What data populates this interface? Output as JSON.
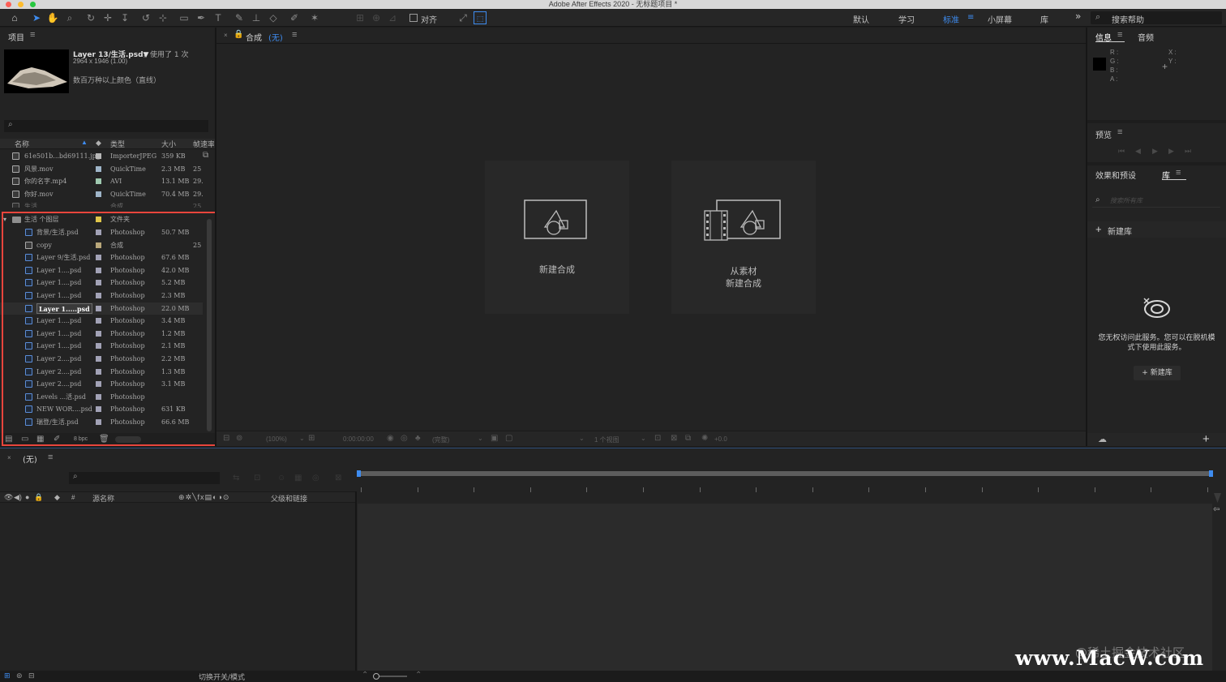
{
  "title_bar": {
    "title": "Adobe After Effects 2020 - 无标题项目 *"
  },
  "toolbar": {
    "snap_label": "对齐",
    "workspaces": [
      "默认",
      "学习",
      "标准",
      "小屏幕",
      "库"
    ],
    "active_workspace": "标准",
    "help_search_placeholder": "搜索帮助"
  },
  "project_panel": {
    "tab": "项目",
    "asset": {
      "name": "Layer 13/生活.psd▼",
      "used": "，使用了 1 次",
      "dimensions": "2964 x 1946 (1.00)",
      "color_info": "数百万种以上颜色（直线）"
    },
    "columns": {
      "name": "名称",
      "type": "类型",
      "size": "大小",
      "fps": "帧速率"
    },
    "items": [
      {
        "name": "61e501b...bd69111.jpg",
        "type": "ImporterJPEG",
        "size": "359 KB",
        "fps": ""
      },
      {
        "name": "风景.mov",
        "type": "QuickTime",
        "size": "2.3 MB",
        "fps": "25"
      },
      {
        "name": "你的名字.mp4",
        "type": "AVI",
        "size": "13.1 MB",
        "fps": "29."
      },
      {
        "name": "你好.mov",
        "type": "QuickTime",
        "size": "70.4 MB",
        "fps": "29."
      },
      {
        "name": "生活",
        "type": "合成",
        "size": "",
        "fps": "25"
      }
    ],
    "folder": {
      "name": "生活 个图层",
      "type": "文件夹"
    },
    "folder_items": [
      {
        "name": "背景/生活.psd",
        "type": "Photoshop",
        "size": "50.7 MB",
        "fps": ""
      },
      {
        "name": "copy",
        "type": "合成",
        "size": "",
        "fps": "25"
      },
      {
        "name": "Layer 9/生活.psd",
        "type": "Photoshop",
        "size": "67.6 MB",
        "fps": ""
      },
      {
        "name": "Layer 1....psd",
        "type": "Photoshop",
        "size": "42.0 MB",
        "fps": ""
      },
      {
        "name": "Layer 1....psd",
        "type": "Photoshop",
        "size": "5.2 MB",
        "fps": ""
      },
      {
        "name": "Layer 1....psd",
        "type": "Photoshop",
        "size": "2.3 MB",
        "fps": ""
      },
      {
        "name": "Layer 1.....psd",
        "type": "Photoshop",
        "size": "22.0 MB",
        "fps": ""
      },
      {
        "name": "Layer 1....psd",
        "type": "Photoshop",
        "size": "3.4 MB",
        "fps": ""
      },
      {
        "name": "Layer 1....psd",
        "type": "Photoshop",
        "size": "1.2 MB",
        "fps": ""
      },
      {
        "name": "Layer 1....psd",
        "type": "Photoshop",
        "size": "2.1 MB",
        "fps": ""
      },
      {
        "name": "Layer 2....psd",
        "type": "Photoshop",
        "size": "2.2 MB",
        "fps": ""
      },
      {
        "name": "Layer 2....psd",
        "type": "Photoshop",
        "size": "1.3 MB",
        "fps": ""
      },
      {
        "name": "Layer 2....psd",
        "type": "Photoshop",
        "size": "3.1 MB",
        "fps": ""
      },
      {
        "name": "Levels ...活.psd",
        "type": "Photoshop",
        "size": "",
        "fps": ""
      },
      {
        "name": "NEW WOR....psd",
        "type": "Photoshop",
        "size": "631 KB",
        "fps": ""
      },
      {
        "name": "瑞登/生活.psd",
        "type": "Photoshop",
        "size": "66.6 MB",
        "fps": ""
      }
    ],
    "selected_index": 6,
    "bpc": "8 bpc"
  },
  "composition_panel": {
    "tab": "合成",
    "comp_name": "(无)",
    "new_comp_label": "新建合成",
    "from_footage_line1": "从素材",
    "from_footage_line2": "新建合成",
    "zoom": "(100%)",
    "timecode": "0:00:00:00",
    "resolution": "(完整)",
    "views": "1 个视图",
    "exposure": "+0.0"
  },
  "info_panel": {
    "tab": "信息",
    "audio_tab": "音频",
    "channels": [
      "R :",
      "G :",
      "B :",
      "A :"
    ],
    "coords": [
      "X :",
      "Y :"
    ]
  },
  "preview_panel": {
    "tab": "预览"
  },
  "library_panel": {
    "effects_tab": "效果和预设",
    "library_tab": "库",
    "search_placeholder": "搜索所有库",
    "new_library": "新建库",
    "offline_message_line1": "您无权访问此服务。您可以在脱机模",
    "offline_message_line2": "式下使用此服务。",
    "new_library_button": "+ 新建库"
  },
  "timeline_panel": {
    "tab": "(无)",
    "source_name_col": "源名称",
    "parent_col": "父级和链接",
    "toggle_label": "切换开关/模式"
  },
  "watermark": {
    "main": "www.MacW.com",
    "secondary": "@稀土掘金技术社区"
  },
  "colors": {
    "accent": "#3e8cf0",
    "highlight_box": "#e8453c"
  }
}
